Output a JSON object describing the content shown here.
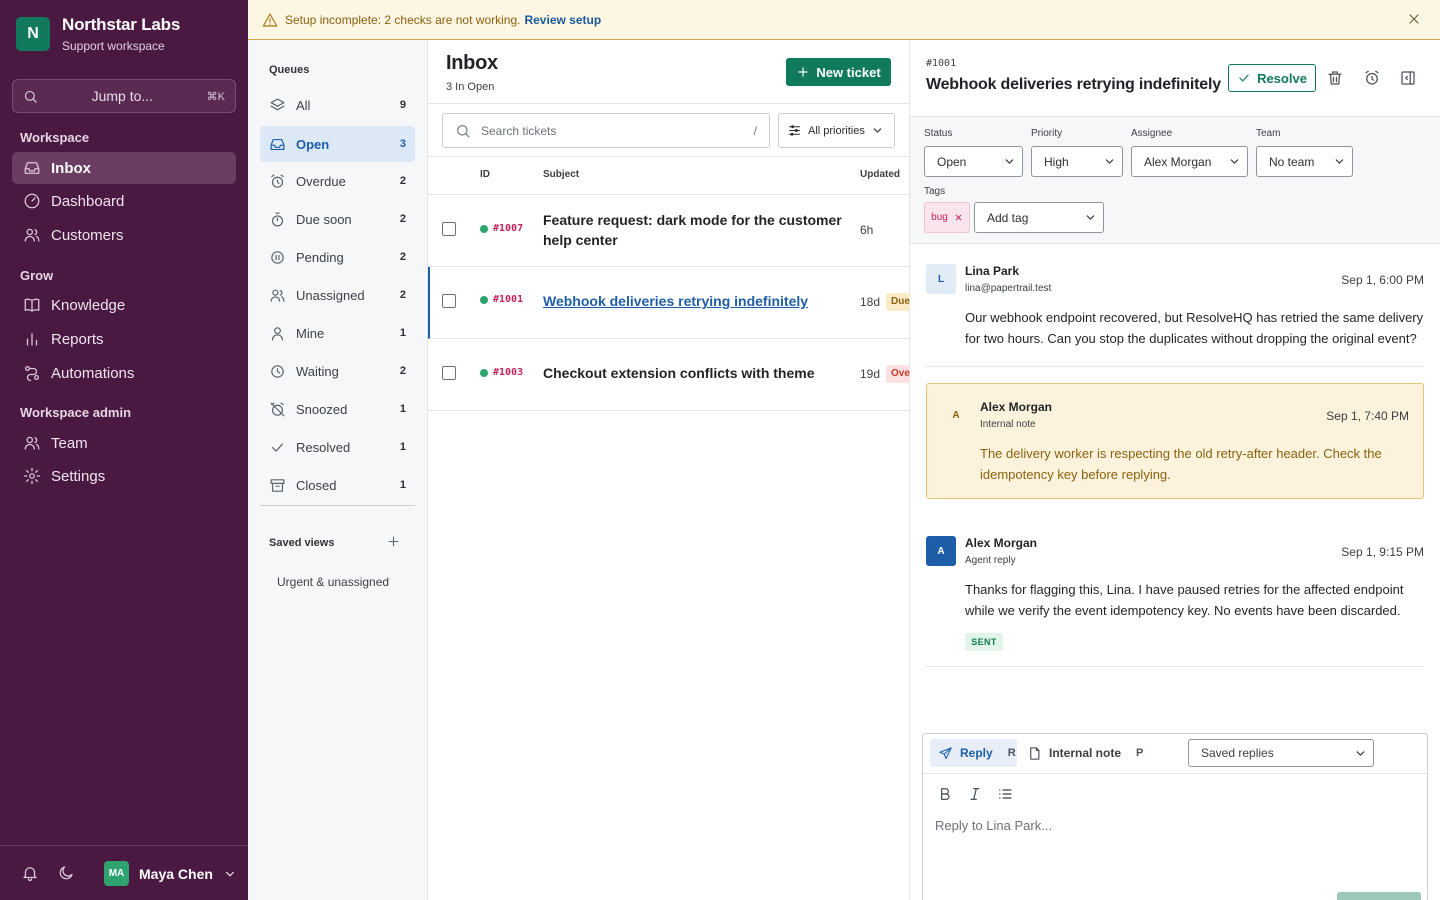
{
  "banner": {
    "message": "Setup incomplete: 2 checks are not working.",
    "link": "Review setup"
  },
  "sidebar": {
    "logo_letter": "N",
    "org_name": "Northstar Labs",
    "org_sub": "Support workspace",
    "jump": {
      "label": "Jump to...",
      "shortcut": "⌘K"
    },
    "sections": [
      {
        "title": "Workspace",
        "items": [
          {
            "label": "Inbox",
            "icon": "inbox-icon",
            "active": true
          },
          {
            "label": "Dashboard",
            "icon": "gauge-icon"
          },
          {
            "label": "Customers",
            "icon": "users-icon"
          }
        ]
      },
      {
        "title": "Grow",
        "items": [
          {
            "label": "Knowledge",
            "icon": "book-icon"
          },
          {
            "label": "Reports",
            "icon": "bar-chart-icon"
          },
          {
            "label": "Automations",
            "icon": "workflow-icon"
          }
        ]
      },
      {
        "title": "Workspace admin",
        "items": [
          {
            "label": "Team",
            "icon": "team-icon"
          },
          {
            "label": "Settings",
            "icon": "gear-icon"
          }
        ]
      }
    ],
    "user": {
      "initials": "MA",
      "name": "Maya Chen"
    }
  },
  "queues": {
    "heading": "Queues",
    "items": [
      {
        "label": "All",
        "count": "9"
      },
      {
        "label": "Open",
        "count": "3",
        "active": true
      },
      {
        "label": "Overdue",
        "count": "2"
      },
      {
        "label": "Due soon",
        "count": "2"
      },
      {
        "label": "Pending",
        "count": "2"
      },
      {
        "label": "Unassigned",
        "count": "2"
      },
      {
        "label": "Mine",
        "count": "1"
      },
      {
        "label": "Waiting",
        "count": "2"
      },
      {
        "label": "Snoozed",
        "count": "1"
      },
      {
        "label": "Resolved",
        "count": "1"
      },
      {
        "label": "Closed",
        "count": "1"
      }
    ],
    "saved_heading": "Saved views",
    "saved_views": [
      "Urgent & unassigned"
    ]
  },
  "list": {
    "title": "Inbox",
    "subtitle": "3 In Open",
    "new_ticket": "New ticket",
    "search_placeholder": "Search tickets",
    "search_shortcut": "/",
    "priority_filter": "All priorities",
    "columns": {
      "id": "ID",
      "subject": "Subject",
      "updated": "Updated"
    },
    "tickets": [
      {
        "id": "#1007",
        "subject": "Feature request: dark mode for the customer help center",
        "updated": "6h",
        "badge": ""
      },
      {
        "id": "#1001",
        "subject": "Webhook deliveries retrying indefinitely",
        "updated": "18d",
        "badge": "Due",
        "badge_color": "#fbecc8",
        "badge_text_color": "#8a6110",
        "selected": true
      },
      {
        "id": "#1003",
        "subject": "Checkout extension conflicts with theme",
        "updated": "19d",
        "badge": "Ove",
        "badge_color": "#fde0e0",
        "badge_text_color": "#c0392b"
      }
    ]
  },
  "detail": {
    "number": "#1001",
    "title": "Webhook deliveries retrying indefinitely",
    "resolve": "Resolve",
    "fields": {
      "status": {
        "label": "Status",
        "value": "Open"
      },
      "priority": {
        "label": "Priority",
        "value": "High"
      },
      "assignee": {
        "label": "Assignee",
        "value": "Alex Morgan"
      },
      "team": {
        "label": "Team",
        "value": "No team"
      }
    },
    "tags_label": "Tags",
    "tag": "bug",
    "add_tag": "Add tag",
    "messages": [
      {
        "initial": "L",
        "name": "Lina Park",
        "meta": "lina@papertrail.test",
        "time": "Sep 1, 6:00 PM",
        "body": "Our webhook endpoint recovered, but ResolveHQ has retried the same delivery for two hours. Can you stop the duplicates without dropping the original event?"
      },
      {
        "initial": "A",
        "name": "Alex Morgan",
        "meta": "Internal note",
        "time": "Sep 1, 7:40 PM",
        "body": "The delivery worker is respecting the old retry-after header. Check the idempotency key before replying."
      },
      {
        "initial": "A",
        "name": "Alex Morgan",
        "meta": "Agent reply",
        "time": "Sep 1, 9:15 PM",
        "body": "Thanks for flagging this, Lina. I have paused retries for the affected endpoint while we verify the event idempotency key. No events have been discarded.",
        "badge": "SENT"
      }
    ],
    "composer": {
      "reply_tab": "Reply",
      "reply_key": "R",
      "note_tab": "Internal note",
      "note_key": "P",
      "saved_replies": "Saved replies",
      "placeholder": "Reply to Lina Park..."
    }
  },
  "colors": {
    "sidebar": "#4a1942",
    "accent": "#117a5d",
    "link": "#1e5ea8",
    "ticket_id": "#c4225a"
  }
}
